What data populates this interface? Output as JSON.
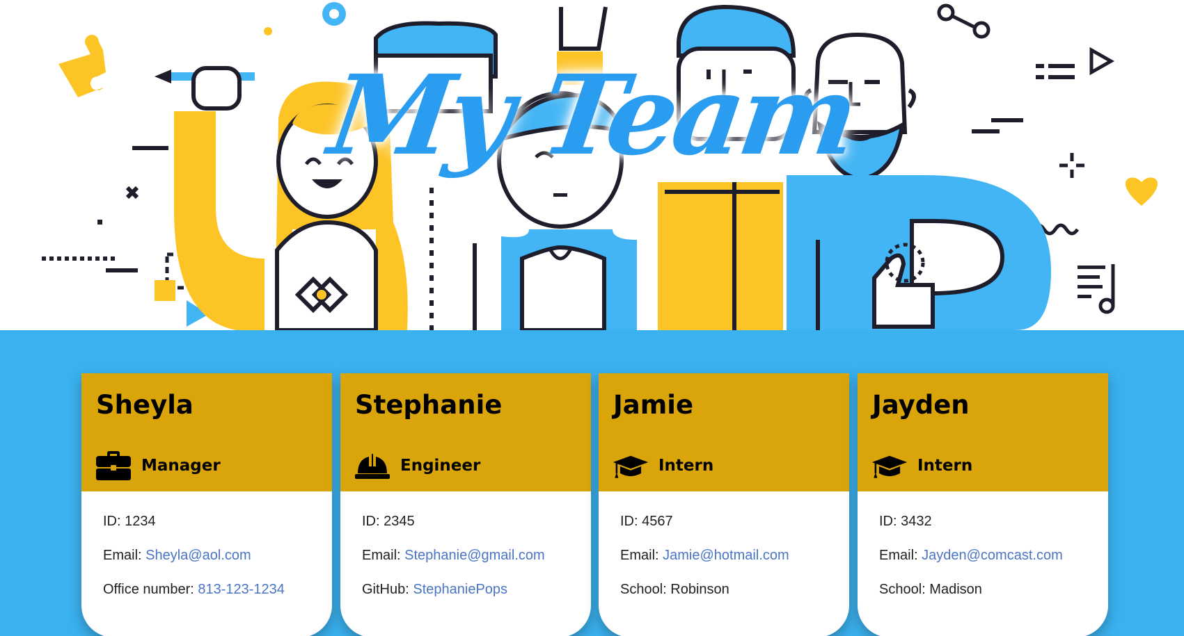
{
  "header": {
    "title": "My Team"
  },
  "colors": {
    "hero_title": "#2b9df0",
    "team_background": "#3bb1ef",
    "card_header": "#d9a50a",
    "link": "#4a74c4",
    "illustration_yellow": "#fdc426",
    "illustration_blue": "#43b5f4"
  },
  "team": [
    {
      "name": "Sheyla",
      "role": "Manager",
      "role_icon": "briefcase-icon",
      "id_label": "ID:",
      "id": "1234",
      "email_label": "Email:",
      "email": "Sheyla@aol.com",
      "extra_label": "Office number:",
      "extra_value": "813-123-1234"
    },
    {
      "name": "Stephanie",
      "role": "Engineer",
      "role_icon": "hard-hat-icon",
      "id_label": "ID:",
      "id": "2345",
      "email_label": "Email:",
      "email": "Stephanie@gmail.com",
      "extra_label": "GitHub:",
      "extra_value": "StephaniePops"
    },
    {
      "name": "Jamie",
      "role": "Intern",
      "role_icon": "graduation-cap-icon",
      "id_label": "ID:",
      "id": "4567",
      "email_label": "Email:",
      "email": "Jamie@hotmail.com",
      "extra_label": "School:",
      "extra_value": "Robinson"
    },
    {
      "name": "Jayden",
      "role": "Intern",
      "role_icon": "graduation-cap-icon",
      "id_label": "ID:",
      "id": "3432",
      "email_label": "Email:",
      "email": "Jayden@comcast.com",
      "extra_label": "School:",
      "extra_value": "Madison"
    }
  ]
}
